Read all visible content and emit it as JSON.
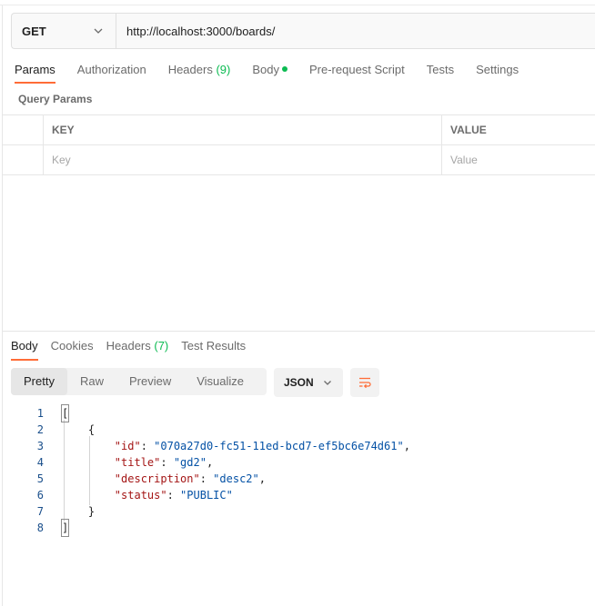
{
  "request": {
    "method": "GET",
    "url": "http://localhost:3000/boards/"
  },
  "request_tabs": {
    "params": "Params",
    "authorization": "Authorization",
    "headers": "Headers",
    "headers_count": "(9)",
    "body": "Body",
    "prerequest": "Pre-request Script",
    "tests": "Tests",
    "settings": "Settings"
  },
  "query_params": {
    "title": "Query Params",
    "key_header": "KEY",
    "value_header": "VALUE",
    "key_placeholder": "Key",
    "value_placeholder": "Value"
  },
  "response_tabs": {
    "body": "Body",
    "cookies": "Cookies",
    "headers": "Headers",
    "headers_count": "(7)",
    "test_results": "Test Results"
  },
  "format": {
    "pretty": "Pretty",
    "raw": "Raw",
    "preview": "Preview",
    "visualize": "Visualize",
    "language": "JSON"
  },
  "code": {
    "line_numbers": [
      "1",
      "2",
      "3",
      "4",
      "5",
      "6",
      "7",
      "8"
    ],
    "open_bracket": "[",
    "open_brace": "{",
    "id_key": "\"id\"",
    "id_val": "\"070a27d0-fc51-11ed-bcd7-ef5bc6e74d61\"",
    "title_key": "\"title\"",
    "title_val": "\"gd2\"",
    "desc_key": "\"description\"",
    "desc_val": "\"desc2\"",
    "status_key": "\"status\"",
    "status_val": "\"PUBLIC\"",
    "close_brace": "}",
    "close_bracket": "]"
  },
  "colors": {
    "accent": "#ff6c37",
    "count_green": "#0cbb52",
    "json_key": "#a41515",
    "json_string": "#0451a5"
  }
}
